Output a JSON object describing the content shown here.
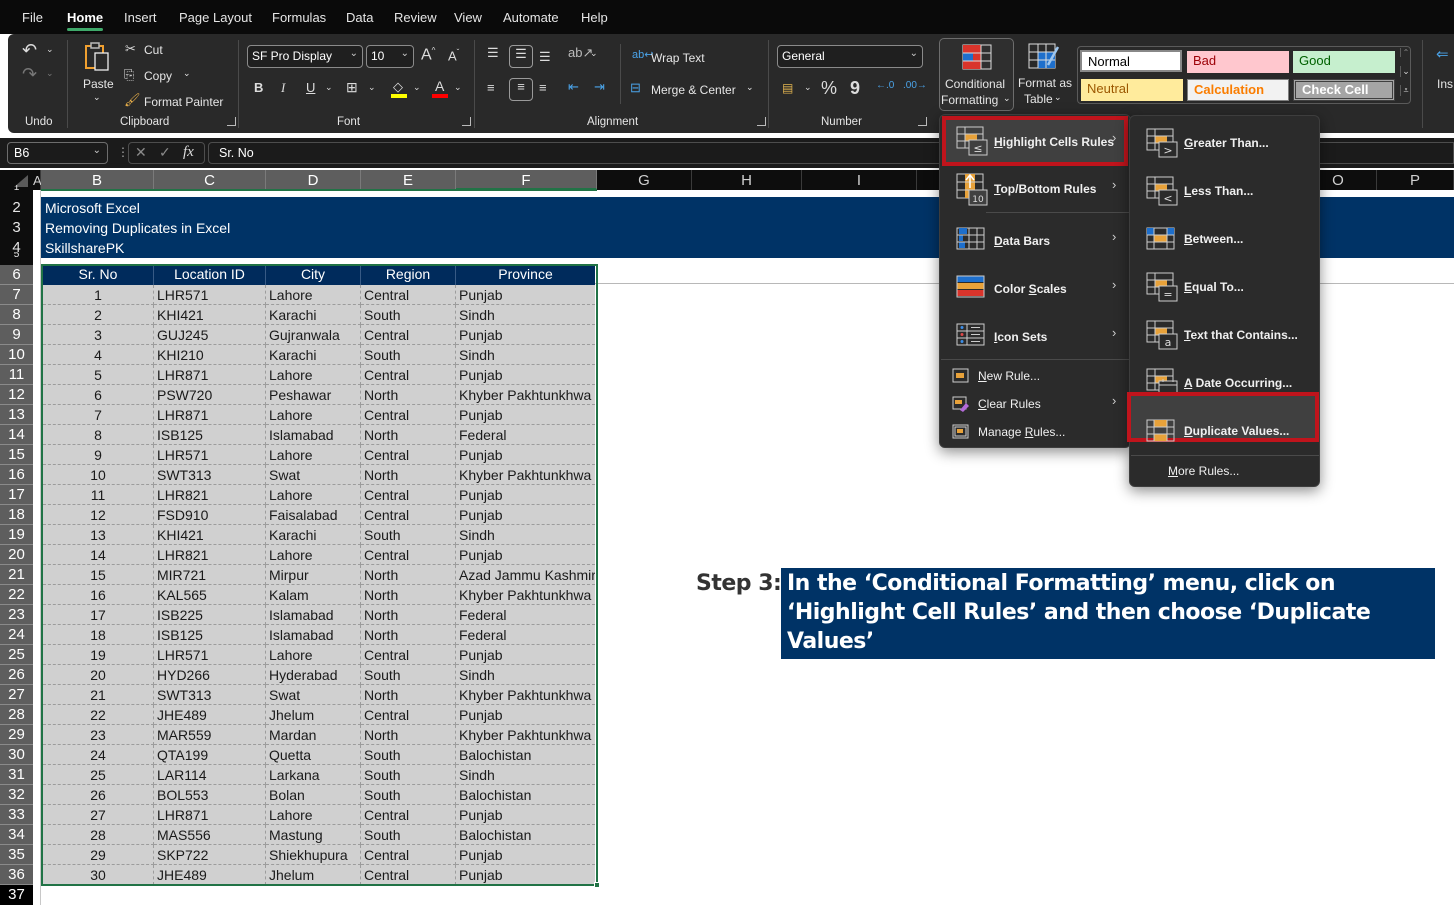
{
  "menu_tabs": [
    "File",
    "Home",
    "Insert",
    "Page Layout",
    "Formulas",
    "Data",
    "Review",
    "View",
    "Automate",
    "Help"
  ],
  "active_tab": "Home",
  "ribbon": {
    "undo": {
      "group_label": "Undo"
    },
    "clipboard": {
      "paste": "Paste",
      "cut": "Cut",
      "copy": "Copy",
      "format_painter": "Format Painter",
      "group_label": "Clipboard"
    },
    "font": {
      "font_name": "SF Pro Display",
      "font_size": "10",
      "bold": "B",
      "italic": "I",
      "underline": "U",
      "group_label": "Font",
      "fill_color": "#ffff00",
      "font_color": "#ff0000"
    },
    "alignment": {
      "wrap_text": "Wrap Text",
      "merge_center": "Merge & Center",
      "group_label": "Alignment"
    },
    "number": {
      "format": "General",
      "percent": "%",
      "comma": "9",
      "group_label": "Number"
    },
    "styles": {
      "conditional_formatting_line1": "Conditional",
      "conditional_formatting_line2": "Formatting",
      "format_as_table_line1": "Format as",
      "format_as_table_line2": "Table",
      "cell_styles": [
        {
          "name": "Normal",
          "bg": "#ffffff",
          "fg": "#000000"
        },
        {
          "name": "Bad",
          "bg": "#ffc7ce",
          "fg": "#9c0006"
        },
        {
          "name": "Good",
          "bg": "#c6efce",
          "fg": "#006100"
        },
        {
          "name": "Neutral",
          "bg": "#ffeb9c",
          "fg": "#9c5700"
        },
        {
          "name": "Calculation",
          "bg": "#f2f2f2",
          "fg": "#fa7d00"
        },
        {
          "name": "Check Cell",
          "bg": "#a5a5a5",
          "fg": "#ffffff"
        }
      ]
    },
    "cells": {
      "insert": "Ins"
    }
  },
  "formula_bar": {
    "name_box": "B6",
    "fx": "fx",
    "content": "Sr. No"
  },
  "columns": [
    "A",
    "B",
    "C",
    "D",
    "E",
    "F",
    "G",
    "H",
    "I",
    "O",
    "P"
  ],
  "rows": [
    "1",
    "2",
    "3",
    "4",
    "5",
    "6",
    "7",
    "8",
    "9",
    "10",
    "11",
    "12",
    "13",
    "14",
    "15",
    "16",
    "17",
    "18",
    "19",
    "20",
    "21",
    "22",
    "23",
    "24",
    "25",
    "26",
    "27",
    "28",
    "29",
    "30",
    "31",
    "32",
    "33",
    "34",
    "35",
    "36",
    "37"
  ],
  "banner": {
    "line1": "Microsoft Excel",
    "line2": "Removing Duplicates in Excel",
    "line3": "SkillsharePK"
  },
  "table": {
    "headers": [
      "Sr. No",
      "Location ID",
      "City",
      "Region",
      "Province"
    ],
    "rows": [
      [
        "1",
        "LHR571",
        "Lahore",
        "Central",
        "Punjab"
      ],
      [
        "2",
        "KHI421",
        "Karachi",
        "South",
        "Sindh"
      ],
      [
        "3",
        "GUJ245",
        "Gujranwala",
        "Central",
        "Punjab"
      ],
      [
        "4",
        "KHI210",
        "Karachi",
        "South",
        "Sindh"
      ],
      [
        "5",
        "LHR871",
        "Lahore",
        "Central",
        "Punjab"
      ],
      [
        "6",
        "PSW720",
        "Peshawar",
        "North",
        "Khyber Pakhtunkhwa"
      ],
      [
        "7",
        "LHR871",
        "Lahore",
        "Central",
        "Punjab"
      ],
      [
        "8",
        "ISB125",
        "Islamabad",
        "North",
        "Federal"
      ],
      [
        "9",
        "LHR571",
        "Lahore",
        "Central",
        "Punjab"
      ],
      [
        "10",
        "SWT313",
        "Swat",
        "North",
        "Khyber Pakhtunkhwa"
      ],
      [
        "11",
        "LHR821",
        "Lahore",
        "Central",
        "Punjab"
      ],
      [
        "12",
        "FSD910",
        "Faisalabad",
        "Central",
        "Punjab"
      ],
      [
        "13",
        "KHI421",
        "Karachi",
        "South",
        "Sindh"
      ],
      [
        "14",
        "LHR821",
        "Lahore",
        "Central",
        "Punjab"
      ],
      [
        "15",
        "MIR721",
        "Mirpur",
        "North",
        "Azad Jammu Kashmir"
      ],
      [
        "16",
        "KAL565",
        "Kalam",
        "North",
        "Khyber Pakhtunkhwa"
      ],
      [
        "17",
        "ISB225",
        "Islamabad",
        "North",
        "Federal"
      ],
      [
        "18",
        "ISB125",
        "Islamabad",
        "North",
        "Federal"
      ],
      [
        "19",
        "LHR571",
        "Lahore",
        "Central",
        "Punjab"
      ],
      [
        "20",
        "HYD266",
        "Hyderabad",
        "South",
        "Sindh"
      ],
      [
        "21",
        "SWT313",
        "Swat",
        "North",
        "Khyber Pakhtunkhwa"
      ],
      [
        "22",
        "JHE489",
        "Jhelum",
        "Central",
        "Punjab"
      ],
      [
        "23",
        "MAR559",
        "Mardan",
        "North",
        "Khyber Pakhtunkhwa"
      ],
      [
        "24",
        "QTA199",
        "Quetta",
        "South",
        "Balochistan"
      ],
      [
        "25",
        "LAR114",
        "Larkana",
        "South",
        "Sindh"
      ],
      [
        "26",
        "BOL553",
        "Bolan",
        "South",
        "Balochistan"
      ],
      [
        "27",
        "LHR871",
        "Lahore",
        "Central",
        "Punjab"
      ],
      [
        "28",
        "MAS556",
        "Mastung",
        "South",
        "Balochistan"
      ],
      [
        "29",
        "SKP722",
        "Shiekhupura",
        "Central",
        "Punjab"
      ],
      [
        "30",
        "JHE489",
        "Jhelum",
        "Central",
        "Punjab"
      ]
    ]
  },
  "cf_menu": {
    "items": [
      {
        "label": "Highlight Cells Rules",
        "accel": "H",
        "rest": "ighlight Cells Rules",
        "submenu": true,
        "highlighted": true
      },
      {
        "label": "Top/Bottom Rules",
        "accel": "T",
        "rest": "op/Bottom Rules",
        "submenu": true
      },
      {
        "label": "Data Bars",
        "accel": "D",
        "rest": "ata Bars",
        "submenu": true
      },
      {
        "label": "Color Scales",
        "accel": "S",
        "pre": "Color ",
        "rest": "cales",
        "submenu": true
      },
      {
        "label": "Icon Sets",
        "accel": "I",
        "rest": "con Sets",
        "submenu": true
      }
    ],
    "small_items": [
      {
        "label": "New Rule...",
        "accel": "N",
        "rest": "ew Rule..."
      },
      {
        "label": "Clear Rules",
        "accel": "C",
        "rest": "lear Rules",
        "submenu": true
      },
      {
        "label": "Manage Rules...",
        "pre": "Manage ",
        "accel": "R",
        "rest": "ules..."
      }
    ]
  },
  "highlight_submenu": {
    "items": [
      {
        "label": "Greater Than...",
        "accel": "G",
        "rest": "reater Than..."
      },
      {
        "label": "Less Than...",
        "accel": "L",
        "rest": "ess Than..."
      },
      {
        "label": "Between...",
        "accel": "B",
        "rest": "etween..."
      },
      {
        "label": "Equal To...",
        "accel": "E",
        "rest": "qual To..."
      },
      {
        "label": "Text that Contains...",
        "accel": "T",
        "rest": "ext that Contains..."
      },
      {
        "label": "A Date Occurring...",
        "accel": "A",
        "rest": " Date Occurring..."
      },
      {
        "label": "Duplicate Values...",
        "accel": "D",
        "rest": "uplicate Values...",
        "highlighted": true
      }
    ],
    "more_rules": {
      "label": "More Rules...",
      "accel": "M",
      "rest": "ore Rules..."
    }
  },
  "annotation": {
    "step": "Step 3:",
    "text": "In the ‘Conditional Formatting’ menu, click on ‘Highlight Cell Rules’ and then choose ‘Duplicate Values’"
  },
  "colors": {
    "banner": "#003366",
    "header_fill": "#002b5c",
    "selection": "#217346",
    "menu_highlight_border": "#c0141c",
    "cf_orange": "#e8a23a",
    "cf_blue": "#1e6fcc",
    "cf_red": "#d9342b"
  }
}
